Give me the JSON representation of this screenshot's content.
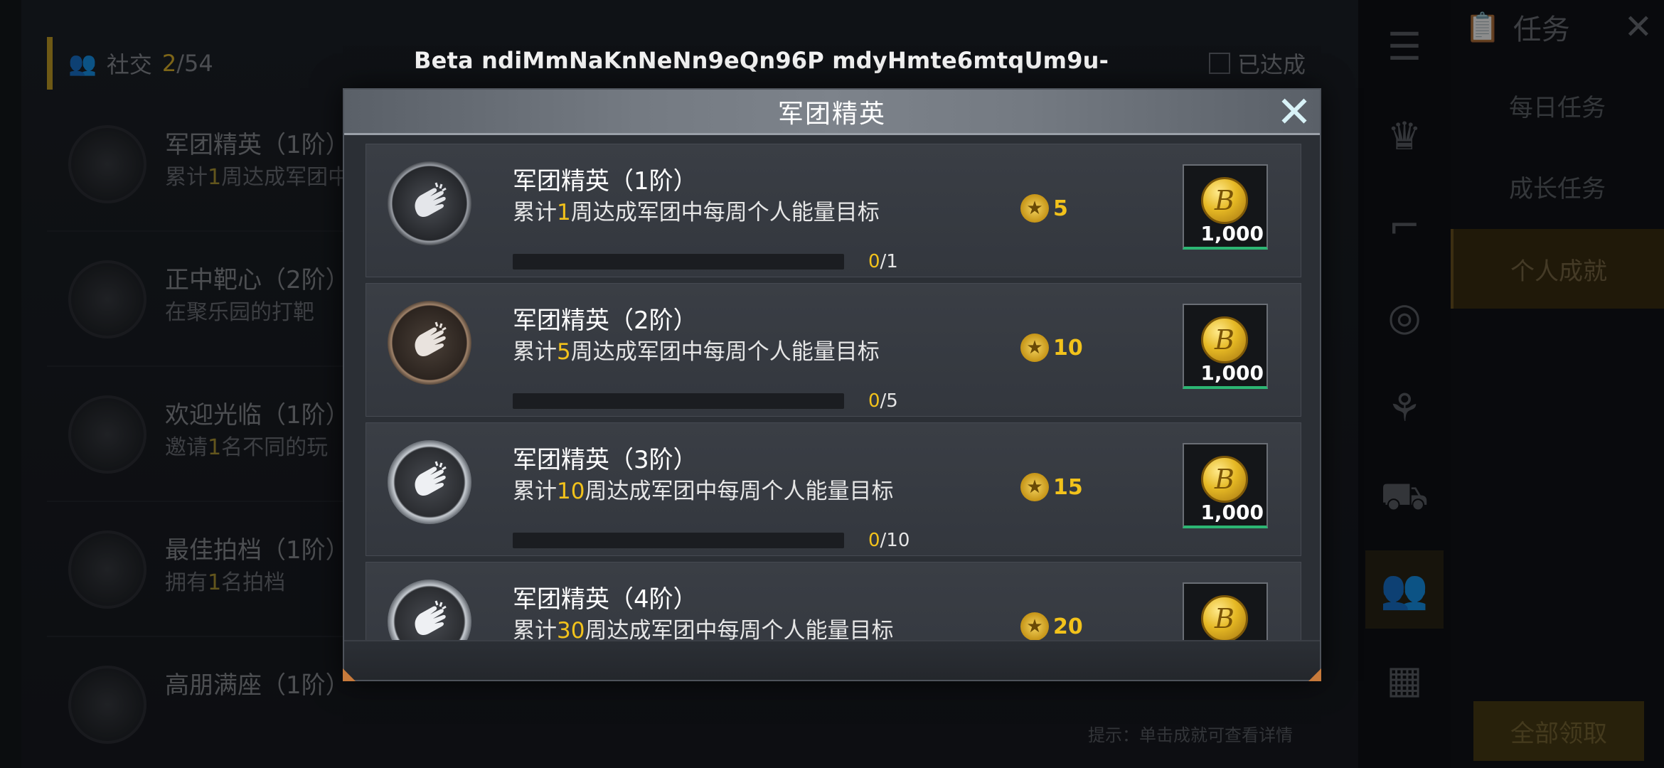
{
  "watermark": "Beta ndiMmNaKnNeNn9eQn96P mdyHmte6mtqUm9u-",
  "background": {
    "social_label": "社交",
    "social_count_current": "2",
    "social_count_total": "/54",
    "achieved_filter_label": "已达成",
    "rows": [
      {
        "title": "军团精英（1阶）",
        "desc_prefix": "累计",
        "desc_hl": "1",
        "desc_suffix": "周达成军团中"
      },
      {
        "title": "正中靶心（2阶）",
        "desc_prefix": "在聚乐园的打靶",
        "desc_hl": "",
        "desc_suffix": ""
      },
      {
        "title": "欢迎光临（1阶）",
        "desc_prefix": "邀请",
        "desc_hl": "1",
        "desc_suffix": "名不同的玩"
      },
      {
        "title": "最佳拍档（1阶）",
        "desc_prefix": "拥有",
        "desc_hl": "1",
        "desc_suffix": "名拍档"
      },
      {
        "title": "高朋满座（1阶）",
        "desc_prefix": "",
        "desc_hl": "",
        "desc_suffix": ""
      }
    ],
    "task_panel": {
      "title": "任务",
      "tabs": [
        "每日任务",
        "成长任务",
        "个人成就"
      ],
      "active_tab": "个人成就",
      "claim_all": "全部领取"
    },
    "hint": "提示：单击成就可查看详情"
  },
  "modal": {
    "title": "军团精英",
    "close_icon": "close-icon",
    "items": [
      {
        "title": "军团精英（1阶）",
        "desc_prefix": "累计",
        "desc_hl": "1",
        "desc_suffix": "周达成军团中每周个人能量目标",
        "progress_current": "0",
        "progress_total": "/1",
        "progress_fraction": 0,
        "points": "5",
        "reward_qty": "1,000",
        "badge": "silver"
      },
      {
        "title": "军团精英（2阶）",
        "desc_prefix": "累计",
        "desc_hl": "5",
        "desc_suffix": "周达成军团中每周个人能量目标",
        "progress_current": "0",
        "progress_total": "/5",
        "progress_fraction": 0,
        "points": "10",
        "reward_qty": "1,000",
        "badge": "bronze"
      },
      {
        "title": "军团精英（3阶）",
        "desc_prefix": "累计",
        "desc_hl": "10",
        "desc_suffix": "周达成军团中每周个人能量目标",
        "progress_current": "0",
        "progress_total": "/10",
        "progress_fraction": 0,
        "points": "15",
        "reward_qty": "1,000",
        "badge": "plate"
      },
      {
        "title": "军团精英（4阶）",
        "desc_prefix": "累计",
        "desc_hl": "30",
        "desc_suffix": "周达成军团中每周个人能量目标",
        "progress_current": "",
        "progress_total": "",
        "progress_fraction": 0,
        "points": "20",
        "reward_qty": "",
        "badge": "plate"
      }
    ]
  },
  "colors": {
    "accent_gold": "#f2c21b",
    "reward_underline": "#2cb673"
  }
}
